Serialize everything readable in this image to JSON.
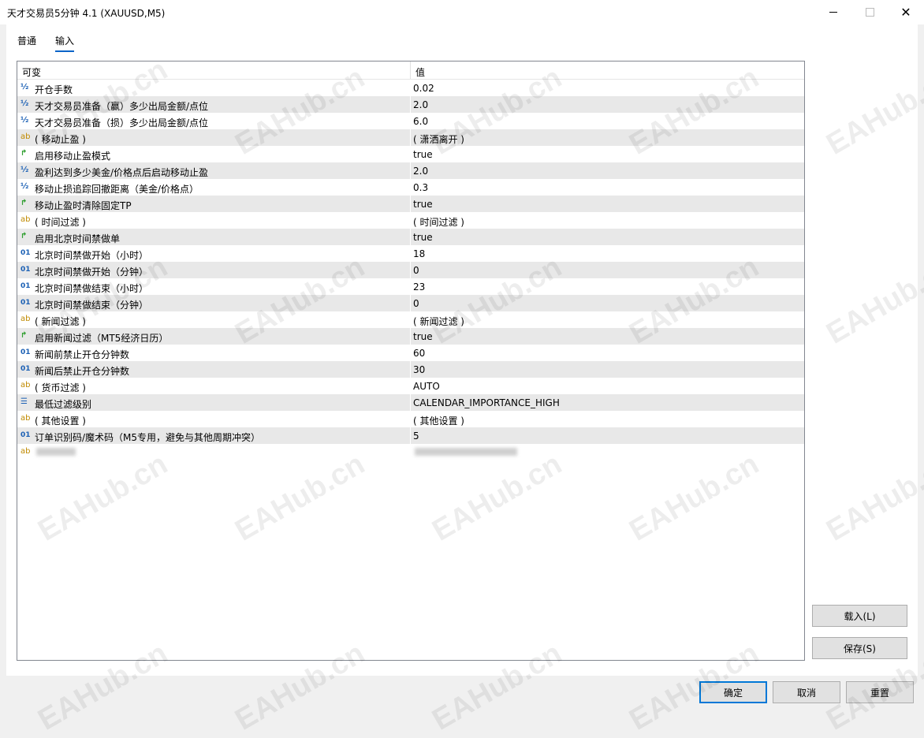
{
  "window": {
    "title": "天才交易员5分钟 4.1 (XAUUSD,M5)"
  },
  "tabs": [
    {
      "label": "普通"
    },
    {
      "label": "输入"
    }
  ],
  "grid": {
    "col_variable": "可变",
    "col_value": "值",
    "rows": [
      {
        "type": "frac",
        "icon": "½",
        "name": "开仓手数",
        "value": "0.02"
      },
      {
        "type": "frac",
        "icon": "½",
        "name": "天才交易员准备（赢）多少出局金额/点位",
        "value": "2.0"
      },
      {
        "type": "frac",
        "icon": "½",
        "name": "天才交易员准备（损）多少出局金额/点位",
        "value": "6.0"
      },
      {
        "type": "ab",
        "icon": "ab",
        "name": "(       移动止盈       )",
        "value": "(       潇洒离开       )"
      },
      {
        "type": "bool",
        "icon": "↱",
        "name": "启用移动止盈模式",
        "value": "true"
      },
      {
        "type": "frac",
        "icon": "½",
        "name": "盈利达到多少美金/价格点后启动移动止盈",
        "value": "2.0"
      },
      {
        "type": "frac",
        "icon": "½",
        "name": "移动止损追踪回撤距离（美金/价格点）",
        "value": "0.3"
      },
      {
        "type": "bool",
        "icon": "↱",
        "name": "移动止盈时清除固定TP",
        "value": "true"
      },
      {
        "type": "ab",
        "icon": "ab",
        "name": "(       时间过滤       )",
        "value": "(       时间过滤       )"
      },
      {
        "type": "bool",
        "icon": "↱",
        "name": "启用北京时间禁做单",
        "value": "true"
      },
      {
        "type": "int",
        "icon": "01",
        "name": "北京时间禁做开始（小时）",
        "value": "18"
      },
      {
        "type": "int",
        "icon": "01",
        "name": "北京时间禁做开始（分钟）",
        "value": "0"
      },
      {
        "type": "int",
        "icon": "01",
        "name": "北京时间禁做结束（小时）",
        "value": "23"
      },
      {
        "type": "int",
        "icon": "01",
        "name": "北京时间禁做结束（分钟）",
        "value": "0"
      },
      {
        "type": "ab",
        "icon": "ab",
        "name": "(       新闻过滤       )",
        "value": "(       新闻过滤       )"
      },
      {
        "type": "bool",
        "icon": "↱",
        "name": "启用新闻过滤（MT5经济日历）",
        "value": "true"
      },
      {
        "type": "int",
        "icon": "01",
        "name": "新闻前禁止开仓分钟数",
        "value": "60"
      },
      {
        "type": "int",
        "icon": "01",
        "name": "新闻后禁止开仓分钟数",
        "value": "30"
      },
      {
        "type": "ab",
        "icon": "ab",
        "name": "(       货币过滤       )",
        "value": "AUTO"
      },
      {
        "type": "enum",
        "icon": "☰",
        "name": "最低过滤级别",
        "value": "CALENDAR_IMPORTANCE_HIGH"
      },
      {
        "type": "ab",
        "icon": "ab",
        "name": "(       其他设置       )",
        "value": "(       其他设置       )"
      },
      {
        "type": "int",
        "icon": "01",
        "name": "订单识别码/魔术码（M5专用，避免与其他周期冲突）",
        "value": "5"
      },
      {
        "type": "ab",
        "icon": "ab",
        "name": "",
        "value": ""
      }
    ]
  },
  "buttons": {
    "load": "载入(L)",
    "save": "保存(S)",
    "ok": "确定",
    "cancel": "取消",
    "reset": "重置"
  },
  "watermark": "EAHub.cn"
}
